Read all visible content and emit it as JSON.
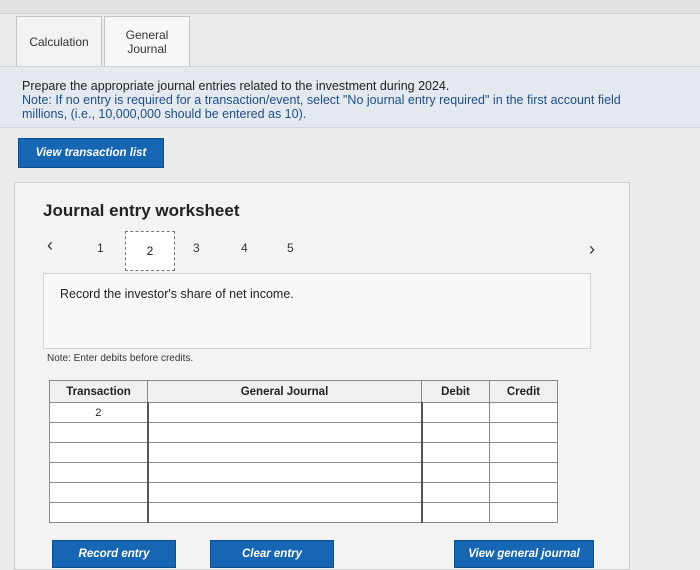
{
  "tabs": [
    {
      "label": "Calculation"
    },
    {
      "label": "General Journal"
    }
  ],
  "instructions": {
    "line1": "Prepare the appropriate journal entries related to the investment during 2024.",
    "note_line1": "Note: If no entry is required for a transaction/event, select \"No journal entry required\" in the first account field",
    "note_line2": "millions, (i.e., 10,000,000 should be entered as 10)."
  },
  "buttons": {
    "view_transaction_list": "View transaction list",
    "record_entry": "Record entry",
    "clear_entry": "Clear entry",
    "view_general_journal": "View general journal"
  },
  "worksheet": {
    "title": "Journal entry worksheet",
    "pages": [
      "1",
      "2",
      "3",
      "4",
      "5"
    ],
    "current_page": "2",
    "description": "Record the investor's share of net income.",
    "note": "Note: Enter debits before credits."
  },
  "table": {
    "headers": {
      "transaction": "Transaction",
      "general_journal": "General Journal",
      "debit": "Debit",
      "credit": "Credit"
    },
    "rows": [
      {
        "transaction": "2",
        "account": "",
        "debit": "",
        "credit": ""
      },
      {
        "transaction": "",
        "account": "",
        "debit": "",
        "credit": ""
      },
      {
        "transaction": "",
        "account": "",
        "debit": "",
        "credit": ""
      },
      {
        "transaction": "",
        "account": "",
        "debit": "",
        "credit": ""
      },
      {
        "transaction": "",
        "account": "",
        "debit": "",
        "credit": ""
      },
      {
        "transaction": "",
        "account": "",
        "debit": "",
        "credit": ""
      }
    ]
  },
  "icons": {
    "prev": "chevron-left-icon",
    "next": "chevron-right-icon"
  },
  "colors": {
    "accent": "#1666b3",
    "instructions_bg": "#e4e9f0",
    "note_text": "#1f4f86"
  }
}
